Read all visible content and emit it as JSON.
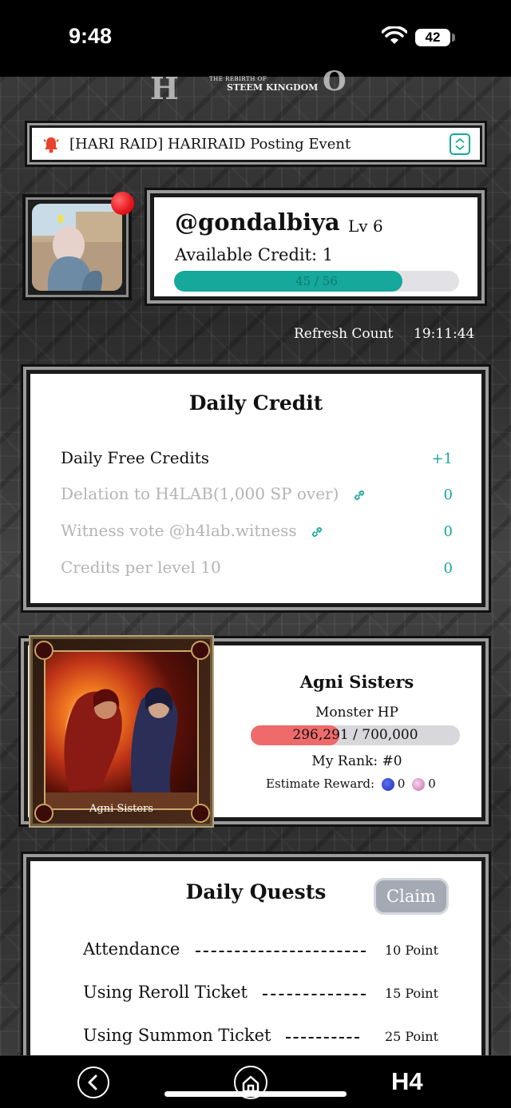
{
  "status_bar": {
    "time": "9:48",
    "battery": "42"
  },
  "logo": {
    "line1": "THE REBIRTH OF",
    "line1b": "THE",
    "line2": "STEEM KINGDOM"
  },
  "event": {
    "label": "[HARI RAID] HARIRAID Posting Event"
  },
  "user": {
    "name": "@gondalbiya",
    "level": "Lv 6",
    "available_credit": "Available Credit: 1",
    "progress_label": "45 / 56",
    "progress_fraction": 0.8
  },
  "refresh": {
    "label": "Refresh Count",
    "time": "19:11:44"
  },
  "daily_credit": {
    "title": "Daily Credit",
    "rows": [
      {
        "label": "Daily Free Credits",
        "value": "+1"
      },
      {
        "label": "Delation to H4LAB(1,000 SP over)",
        "value": "0"
      },
      {
        "label": "Witness vote @h4lab.witness",
        "value": "0"
      },
      {
        "label": "Credits per level 10",
        "value": "0"
      }
    ]
  },
  "boss": {
    "card_name": "Agni Sisters",
    "name": "Agni Sisters",
    "hp_label": "Monster HP",
    "hp_value": "296,291 / 700,000",
    "hp_fraction": 0.423,
    "rank": "My Rank: #0",
    "reward_label": "Estimate Reward:",
    "reward_a": "0",
    "reward_b": "0"
  },
  "quests": {
    "title": "Daily Quests",
    "claim": "Claim",
    "rows": [
      {
        "label": "Attendance",
        "points": "10 Point"
      },
      {
        "label": "Using Reroll Ticket",
        "points": "15 Point"
      },
      {
        "label": "Using Summon Ticket",
        "points": "25 Point"
      }
    ]
  },
  "nav": {
    "brand": "H4"
  },
  "colors": {
    "accent": "#16a89a",
    "hp": "#ef6b6b",
    "notif": "#e8141c"
  }
}
